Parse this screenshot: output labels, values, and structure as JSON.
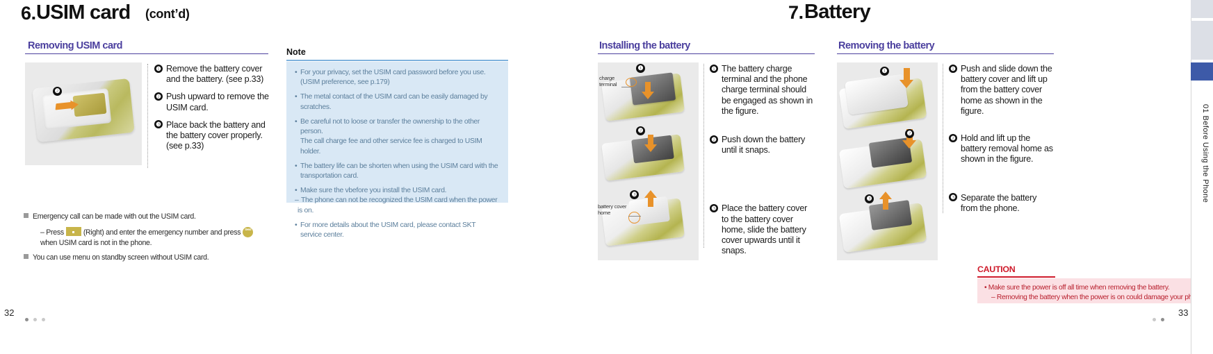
{
  "left_page": {
    "chapter": {
      "number": "6.",
      "title": "USIM card",
      "cont": "(cont’d)"
    },
    "section": {
      "heading": "Removing USIM card"
    },
    "steps": [
      {
        "num": "❶",
        "text": "Remove the battery cover and the battery. (see p.33)"
      },
      {
        "num": "❷",
        "text": "Push upward to remove the USIM card."
      },
      {
        "num": "❸",
        "text": "Place back the battery and the battery cover properly. (see p.33)"
      }
    ],
    "figure_markers": [
      "❷"
    ],
    "note": {
      "label": "Note",
      "lines": [
        {
          "mark": "•",
          "text": "For your privacy, set the USIM card password before you use.",
          "gap": false
        },
        {
          "mark": "",
          "text": "(USIM preference, see p.179)",
          "gap": false
        },
        {
          "mark": "•",
          "text": "The metal contact of the USIM card can be easily damaged by scratches.",
          "gap": true
        },
        {
          "mark": "•",
          "text": "Be careful not to loose or transfer the ownership to the other person.",
          "gap": true
        },
        {
          "mark": "",
          "text": "The call charge fee and other service fee is charged to USIM holder.",
          "gap": false
        },
        {
          "mark": "•",
          "text": "The battery life can be shorten when using the USIM card with the",
          "gap": true
        },
        {
          "mark": "",
          "text": "transportation card.",
          "gap": false
        },
        {
          "mark": "•",
          "text": "Make sure the vbefore you install the USIM card.",
          "gap": true
        },
        {
          "mark": "–",
          "text": "The phone can not be recognized the USIM card when the power is on.",
          "gap": false
        },
        {
          "mark": "•",
          "text": "For more details about the USIM card, please contact SKT service center.",
          "gap": true
        }
      ]
    },
    "footnotes": {
      "item1": "Emergency call can be made with out the USIM card.",
      "sub1_pre": "–  Press",
      "sub1_mid": "(Right) and enter the emergency number and press",
      "sub1_next": "when USIM card is not in the phone.",
      "item2": "You can use menu on standby screen without USIM card.",
      "key_send_label": "Send"
    },
    "page_number": "32"
  },
  "right_page": {
    "chapter": {
      "number": "7.",
      "title": "Battery"
    },
    "install": {
      "heading": "Installing the battery",
      "callouts": {
        "charge_terminal": "charge\nterminal",
        "battery_cover_home": "battery cover\nhome"
      },
      "figure_markers": [
        "❶",
        "❷",
        "❸"
      ],
      "steps": [
        {
          "num": "❶",
          "text": "The battery charge terminal and the phone charge terminal should be engaged as shown in the figure."
        },
        {
          "num": "❷",
          "text": "Push down the battery until it snaps."
        },
        {
          "num": "❸",
          "text": "Place the battery cover to the battery cover home, slide the battery cover upwards until it snaps."
        }
      ]
    },
    "remove": {
      "heading": "Removing the battery",
      "figure_markers": [
        "❶",
        "❷",
        "❸"
      ],
      "steps": [
        {
          "num": "❶",
          "text": "Push and slide down the battery cover and lift up from the battery cover home as shown in the figure."
        },
        {
          "num": "❷",
          "text": "Hold and lift up the battery removal home as shown in the figure."
        },
        {
          "num": "❸",
          "text": "Separate the battery from the phone."
        }
      ]
    },
    "caution": {
      "label": "CAUTION",
      "lines": [
        {
          "mark": "•",
          "text": "Make sure the power is off all time when removing the battery.",
          "sub": false
        },
        {
          "mark": "–",
          "text": "Removing the battery when the power is on could damage your phone.",
          "sub": true
        }
      ]
    },
    "side_tab": {
      "text": "01  Before Using the Phone"
    },
    "page_number": "33"
  },
  "colors": {
    "accent_purple": "#4b3f9e",
    "note_bg": "#d9e8f5",
    "note_text": "#5c7f9c",
    "caution_red": "#cf1b2b",
    "caution_bg": "#fbe0e4",
    "tab_active": "#3d5aa8",
    "figure_bg": "#eaeaea"
  }
}
